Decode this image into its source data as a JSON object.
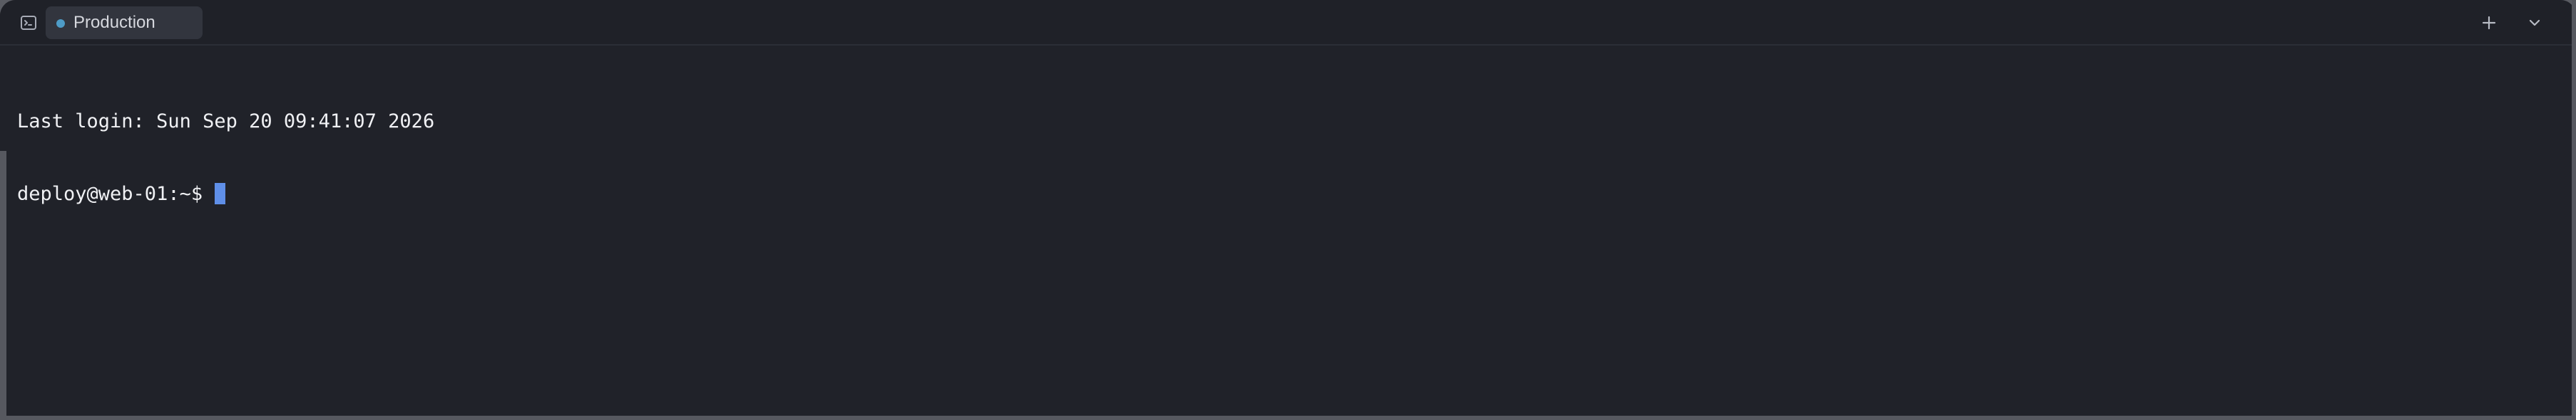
{
  "window": {
    "title_bar": {
      "terminal_icon": "terminal-icon",
      "active_tab": {
        "label": "Production",
        "status_color": "#4e9cc7"
      },
      "actions": {
        "new_tab_icon": "plus-icon",
        "menu_icon": "chevron-down-icon"
      }
    },
    "terminal": {
      "last_login": "Last login: Sun Sep 20 09:41:07 2026",
      "prompt": "deploy@web-01:~$ ",
      "cursor_color": "#5f8fe8"
    }
  },
  "colors": {
    "background": "#202229",
    "tab_background": "#32353e",
    "text": "#f0f1f4"
  }
}
